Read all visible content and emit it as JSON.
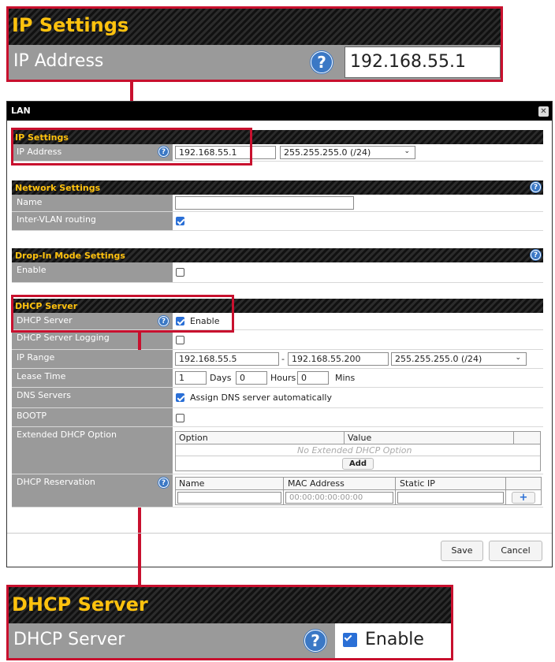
{
  "zoom_ip": {
    "section_title": "IP Settings",
    "label": "IP Address",
    "value": "192.168.55.1"
  },
  "dialog": {
    "title": "LAN",
    "close_icon": "close-icon",
    "ip_settings": {
      "title": "IP Settings",
      "label": "IP Address",
      "ip_value": "192.168.55.1",
      "mask": "255.255.255.0 (/24)"
    },
    "network": {
      "title": "Network Settings",
      "name_label": "Name",
      "name_value": "",
      "intervlan_label": "Inter-VLAN routing",
      "intervlan_checked": true
    },
    "dropin": {
      "title": "Drop-In Mode Settings",
      "enable_label": "Enable",
      "enable_checked": false
    },
    "dhcp": {
      "title": "DHCP Server",
      "server_label": "DHCP Server",
      "enable_text": "Enable",
      "logging_label": "DHCP Server Logging",
      "range_label": "IP Range",
      "range_start": "192.168.55.5",
      "range_dash": "-",
      "range_end": "192.168.55.200",
      "range_mask": "255.255.255.0 (/24)",
      "lease_label": "Lease Time",
      "lease_days": "1",
      "days_text": "Days",
      "lease_hours": "0",
      "hours_text": "Hours",
      "lease_mins": "0",
      "mins_text": "Mins",
      "dns_label": "DNS Servers",
      "dns_text": "Assign DNS server automatically",
      "bootp_label": "BOOTP",
      "ext_label": "Extended DHCP Option",
      "ext_col_option": "Option",
      "ext_col_value": "Value",
      "ext_empty": "No Extended DHCP Option",
      "ext_add": "Add",
      "res_label": "DHCP Reservation",
      "res_col_name": "Name",
      "res_col_mac": "MAC Address",
      "res_col_ip": "Static IP",
      "res_mac_placeholder": "00:00:00:00:00:00",
      "res_add_icon": "plus-icon"
    },
    "save": "Save",
    "cancel": "Cancel",
    "help_icon": "question-icon"
  },
  "zoom_dhcp": {
    "section_title": "DHCP Server",
    "label": "DHCP Server",
    "enable_text": "Enable"
  },
  "colors": {
    "accent_yellow": "#ffc20e",
    "highlight_red": "#c8102e",
    "help_blue": "#3b78c5",
    "label_gray": "#9a9a9a"
  }
}
